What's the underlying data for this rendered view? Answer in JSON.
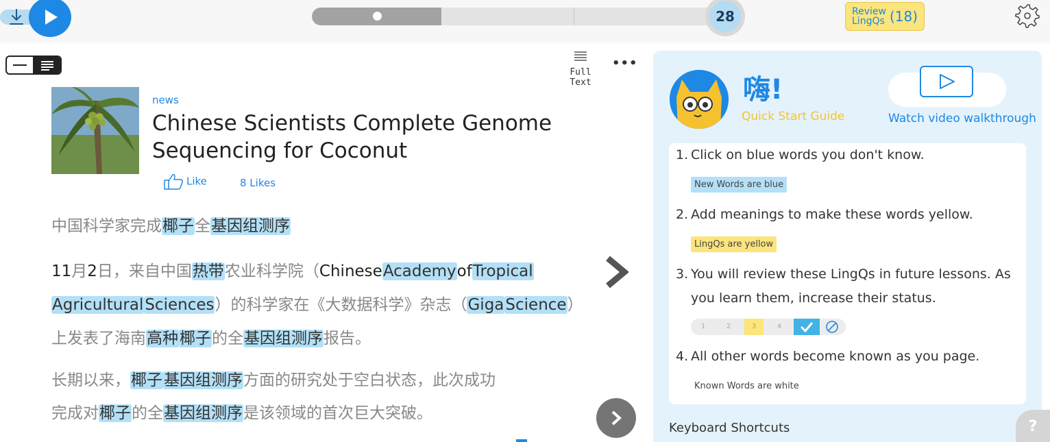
{
  "toolbar": {
    "audio_progress_pct": 31,
    "current_page": "28",
    "review_label_line1": "Review",
    "review_label_line2": "LingQs",
    "review_count": "(18)"
  },
  "reader": {
    "view_toggle": {
      "modes": [
        "sentence-mode-icon",
        "page-mode-icon"
      ],
      "active": "page-mode-icon"
    },
    "full_text_label": "Full Text",
    "more_label": "•••",
    "category": "news",
    "title": "Chinese Scientists Complete Genome Sequencing for Coconut",
    "like_label": "Like",
    "likes_count": "8 Likes",
    "paragraph1": {
      "s1": "中国科学家完成",
      "w1": "椰子",
      "s2": "全",
      "w2": "基因组测序"
    },
    "paragraph2": {
      "k1": "11",
      "s1": "月",
      "k2": "2",
      "s2": "日，来自中国",
      "w1": "热带",
      "s3": "农业科学院（",
      "k3": "Chinese",
      "w2": "Academy",
      "k4": "of",
      "w3": "Tropical",
      "w4": "Agricultural",
      "w5": "Sciences",
      "s4": "）的科学家在《大数据科学》杂志（",
      "w6": "Giga",
      "w7": "Science",
      "s5": "）",
      "s6": "上发表了海南",
      "w8": "高种",
      "w9": "椰子",
      "s7": "的全",
      "w10": "基因组测序",
      "s8": "报告。"
    },
    "paragraph3": {
      "s1": "长期以来，",
      "w1": "椰子",
      "w2": "基因组测序",
      "s2": "方面的研究处于空白状态，此次成功",
      "s3": "完成对",
      "w3": "椰子",
      "s4": "的全",
      "w4": "基因组测序",
      "s5": "是该领域的首次巨大突破。"
    }
  },
  "help": {
    "greeting": "嗨!",
    "quick_start": "Quick Start Guide",
    "video_label": "Watch video walkthrough",
    "steps": [
      {
        "num": "1.",
        "text": "Click on blue words you don't know."
      },
      {
        "num": "2.",
        "text": "Add meanings to make these words yellow."
      },
      {
        "num": "3.",
        "text": "You will review these LingQs in future lessons. As"
      },
      {
        "num": "",
        "text": "you learn them, increase their status."
      },
      {
        "num": "4.",
        "text": "All other words become known as you page."
      }
    ],
    "chip_blue": "New Words are blue",
    "chip_yellow": "LingQs are yellow",
    "chip_white": "Known Words are white",
    "status_levels": [
      "1",
      "2",
      "3",
      "4"
    ],
    "active_status": "3",
    "shortcuts_title": "Keyboard Shortcuts",
    "help_button": "?"
  },
  "colors": {
    "accent_blue": "#1e88e5",
    "new_word_blue": "#b3e0f7",
    "lingq_yellow": "#fbe57c",
    "quick_start_yellow": "#f4c431",
    "panel_bg": "#e4f2fb"
  }
}
